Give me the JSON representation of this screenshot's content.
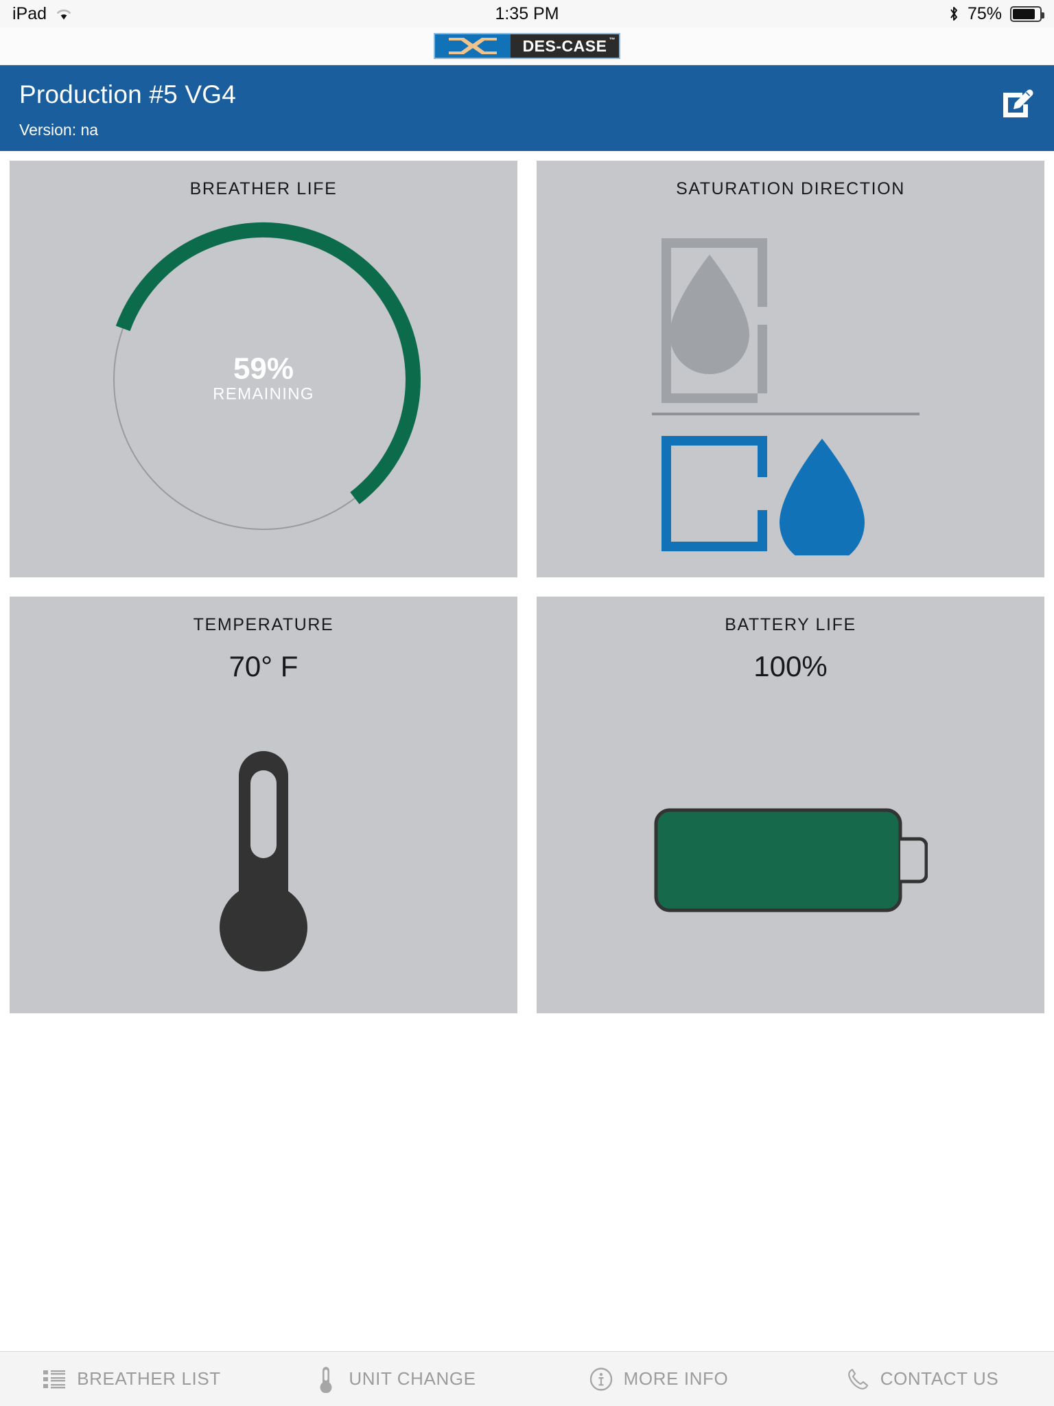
{
  "status_bar": {
    "device": "iPad",
    "wifi_icon": "wifi-icon",
    "time": "1:35 PM",
    "bluetooth_icon": "bluetooth-icon",
    "battery_percent": "75%",
    "battery_fill": 75
  },
  "brand": {
    "logo_mark": "des-case-x-mark",
    "logo_text": "DES-CASE",
    "trademark": "™"
  },
  "header": {
    "title": "Production #5 VG4",
    "version": "Version: na",
    "edit_icon": "edit-pencil-square-icon",
    "background_color": "#1b5e9e"
  },
  "panels": {
    "breather_life": {
      "title": "BREATHER LIFE",
      "percent_text": "59%",
      "percent_value": 59,
      "sub_label": "REMAINING",
      "arc_color": "#0c6b4a",
      "track_color": "#9a9a9a"
    },
    "saturation_direction": {
      "title": "SATURATION DIRECTION",
      "top_icon": "breather-droplet-inside-icon",
      "top_color": "#9fa2a6",
      "divider": "horizontal-divider",
      "bottom_icon": "breather-droplet-outside-icon",
      "bottom_color": "#1272b8"
    },
    "temperature": {
      "title": "TEMPERATURE",
      "value": "70° F",
      "icon": "thermometer-icon",
      "icon_color": "#333333"
    },
    "battery_life": {
      "title": "BATTERY LIFE",
      "value": "100%",
      "fill_percent": 100,
      "icon": "battery-icon",
      "fill_color": "#16694a",
      "outline_color": "#333333"
    }
  },
  "tab_bar": {
    "items": [
      {
        "label": "BREATHER LIST",
        "icon": "list-icon"
      },
      {
        "label": "UNIT CHANGE",
        "icon": "thermometer-icon"
      },
      {
        "label": "MORE INFO",
        "icon": "info-circle-icon"
      },
      {
        "label": "CONTACT US",
        "icon": "phone-icon"
      }
    ],
    "text_color": "#9b9b9b"
  }
}
